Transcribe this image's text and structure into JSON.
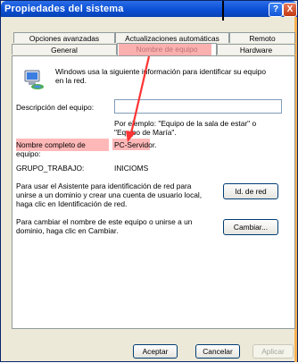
{
  "window": {
    "title": "Propiedades del sistema",
    "help_label": "?",
    "close_label": "X"
  },
  "tabs_top": [
    "Opciones avanzadas",
    "Actualizaciones automáticas",
    "Remoto"
  ],
  "tabs_bottom": [
    "General",
    "Nombre de equipo",
    "Hardware"
  ],
  "active_tab": "Nombre de equipo",
  "intro_text_1": "Windows usa la siguiente información para identificar su equipo",
  "intro_text_2": "en la red.",
  "description": {
    "label": "Descripción del equipo:",
    "value": "",
    "hint_1": "Por ejemplo: \"Equipo de la sala de estar\" o",
    "hint_2": "\"Equipo de María\"."
  },
  "full_name": {
    "label_1": "Nombre completo de",
    "label_2": "equipo:",
    "value": "PC-Servidor."
  },
  "workgroup": {
    "label": "GRUPO_TRABAJO:",
    "value": "INICIOMS"
  },
  "network_id": {
    "text_1": "Para usar el Asistente para identificación de red para",
    "text_2": "unirse a un dominio y crear una cuenta de usuario local,",
    "text_3": "haga clic en Identificación de red.",
    "button": "Id. de red"
  },
  "change": {
    "text_1": "Para cambiar el nombre de este equipo o unirse a un",
    "text_2": "dominio, haga clic en Cambiar.",
    "button": "Cambiar..."
  },
  "footer": {
    "ok": "Aceptar",
    "cancel": "Cancelar",
    "apply": "Aplicar"
  },
  "colors": {
    "titlebar": "#0a4fd4",
    "dialog_bg": "#ece9d8",
    "highlight": "#ffa0a0",
    "arrow": "#ff3333"
  }
}
